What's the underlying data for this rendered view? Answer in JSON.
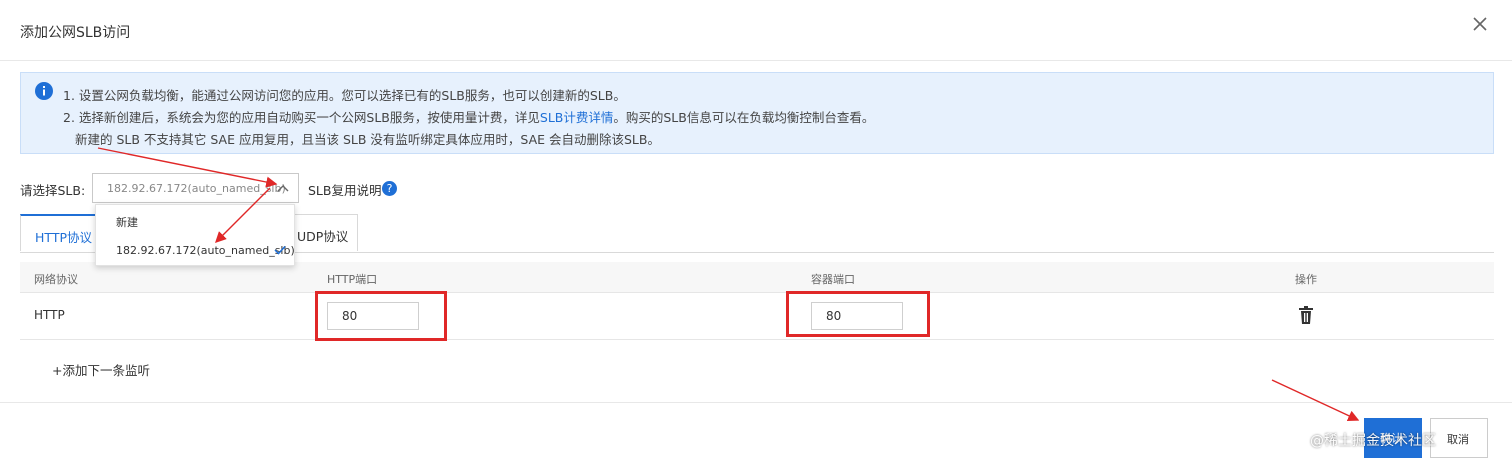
{
  "dialog": {
    "title": "添加公网SLB访问"
  },
  "notice": {
    "line1": "1. 设置公网负载均衡，能通过公网访问您的应用。您可以选择已有的SLB服务，也可以创建新的SLB。",
    "line2_before": "2. 选择新创建后，系统会为您的应用自动购买一个公网SLB服务，按使用量计费，详见",
    "line2_link": "SLB计费详情",
    "line2_after": "。购买的SLB信息可以在负载均衡控制台查看。",
    "line3": "新建的 SLB 不支持其它 SAE 应用复用，且当该 SLB 没有监听绑定具体应用时，SAE 会自动删除该SLB。"
  },
  "slb": {
    "label": "请选择SLB:",
    "selected": "182.92.67.172(auto_named_slb)",
    "help_text": "SLB复用说明",
    "help_icon": "?",
    "options": [
      "新建",
      "182.92.67.172(auto_named_slb)"
    ]
  },
  "tabs": [
    "HTTP协议",
    "UDP协议"
  ],
  "table": {
    "headers": [
      "网络协议",
      "HTTP端口",
      "容器端口",
      "操作"
    ],
    "rows": [
      {
        "protocol": "HTTP",
        "http_port": "80",
        "container_port": "80"
      }
    ]
  },
  "add_button": "+添加下一条监听",
  "footer": {
    "ok": "确认",
    "cancel": "取消"
  },
  "watermark": "@稀土掘金技术社区",
  "colors": {
    "accent": "#1f6fd6",
    "highlight": "#e02828",
    "notice_bg": "#e7f1fd"
  },
  "icons": [
    "close-icon",
    "info-icon",
    "chevron-up-icon",
    "check-icon",
    "help-icon",
    "trash-icon"
  ]
}
